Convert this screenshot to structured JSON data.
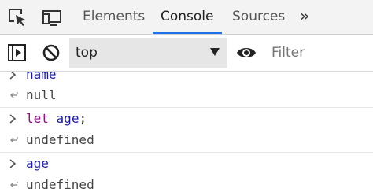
{
  "tabs": [
    {
      "label": "Elements",
      "active": false
    },
    {
      "label": "Console",
      "active": true
    },
    {
      "label": "Sources",
      "active": false
    }
  ],
  "toolbar_icons": {
    "inspect": "cursor-select-icon",
    "device": "device-toggle-icon",
    "more_tabs": "chevron-double-right-icon",
    "sidebar": "console-sidebar-icon",
    "clear": "clear-console-icon",
    "live_expression": "eye-icon"
  },
  "context_selector": {
    "value": "top"
  },
  "filter": {
    "placeholder": "Filter",
    "value": ""
  },
  "console": {
    "entries": [
      {
        "kind": "input",
        "code": "name"
      },
      {
        "kind": "result",
        "text": "null"
      },
      {
        "kind": "input",
        "keyword": "let",
        "code": "age",
        "punct": ";"
      },
      {
        "kind": "result",
        "text": "undefined"
      },
      {
        "kind": "input",
        "code": "age"
      },
      {
        "kind": "result",
        "text": "undefined"
      }
    ]
  },
  "colors": {
    "accent": "#1a73e8",
    "keyword": "#881280",
    "identifier": "#1a1aa6"
  }
}
